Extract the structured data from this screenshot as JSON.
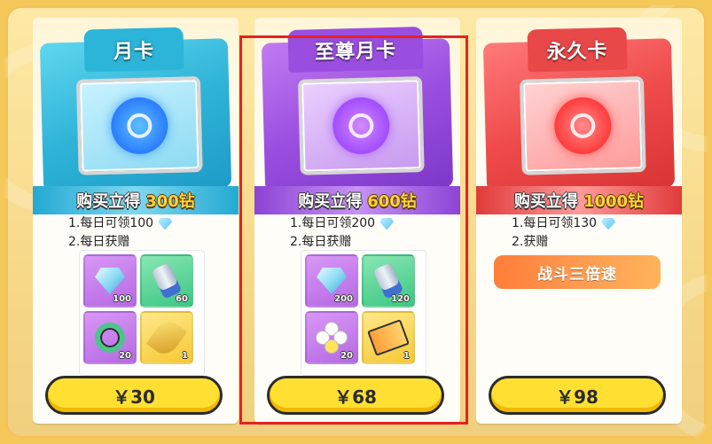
{
  "cards": [
    {
      "title": "月卡",
      "buy_label": "购买立得",
      "buy_amount": "300钻",
      "perks": [
        "1.每日可领100",
        "2.每日获赠"
      ],
      "rewards": [
        {
          "icon": "diamond-icon",
          "count": "100",
          "bg": "purple"
        },
        {
          "icon": "canister-icon",
          "count": "60",
          "bg": "green"
        },
        {
          "icon": "ring-icon",
          "count": "20",
          "bg": "purple"
        },
        {
          "icon": "leaf-icon",
          "count": "1",
          "bg": "yellow"
        }
      ],
      "price": "￥30"
    },
    {
      "title": "至尊月卡",
      "buy_label": "购买立得",
      "buy_amount": "600钻",
      "perks": [
        "1.每日可领200",
        "2.每日获赠"
      ],
      "rewards": [
        {
          "icon": "diamond-icon",
          "count": "200",
          "bg": "purple"
        },
        {
          "icon": "canister-icon",
          "count": "120",
          "bg": "green"
        },
        {
          "icon": "flower-icon",
          "count": "20",
          "bg": "purple"
        },
        {
          "icon": "ticket-icon",
          "count": "1",
          "bg": "yellow"
        }
      ],
      "price": "￥68"
    },
    {
      "title": "永久卡",
      "buy_label": "购买立得",
      "buy_amount": "1000钻",
      "perks": [
        "1.每日可领130",
        "2.获赠"
      ],
      "special": "战斗三倍速",
      "price": "￥98"
    }
  ],
  "colors": {
    "monthly": "#2fb4d8",
    "supreme": "#9b4fe0",
    "permanent": "#ef4b4b",
    "price_button": "#ffe032",
    "selection_border": "#e52222"
  }
}
